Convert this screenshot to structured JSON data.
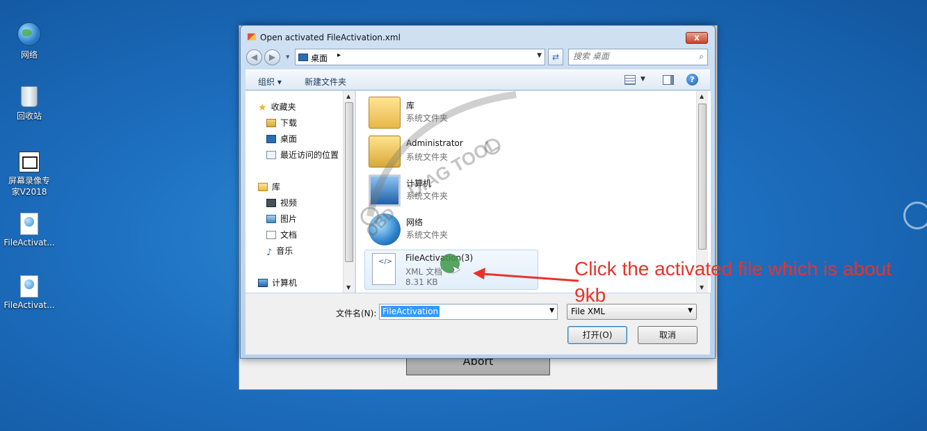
{
  "desktop": {
    "icons": [
      {
        "label": "网络",
        "icon": "network-icon"
      },
      {
        "label": "回收站",
        "icon": "recycle-bin-icon"
      },
      {
        "label": "屏幕录像专家V2018",
        "icon": "screen-recorder-icon"
      },
      {
        "label": "FileActivat...",
        "icon": "xml-file-icon"
      },
      {
        "label": "FileActivat...",
        "icon": "xml-file-icon"
      }
    ]
  },
  "background_window": {
    "abort_label": "Abort"
  },
  "dialog": {
    "title": "Open activated FileActivation.xml",
    "close_label": "x",
    "address": {
      "location": "桌面",
      "arrow": "▸"
    },
    "search": {
      "placeholder": "搜索 桌面"
    },
    "toolbar": {
      "organize": "组织 ▾",
      "new_folder": "新建文件夹",
      "help": "?"
    },
    "tree": {
      "favorites": "收藏夹",
      "downloads": "下载",
      "desktop": "桌面",
      "recent": "最近访问的位置",
      "libraries": "库",
      "videos": "视频",
      "pictures": "图片",
      "documents": "文档",
      "music": "音乐",
      "computer": "计算机"
    },
    "files": [
      {
        "name": "库",
        "type": "系统文件夹",
        "icon": "library-folder-icon"
      },
      {
        "name": "Administrator",
        "type": "系统文件夹",
        "icon": "user-folder-icon"
      },
      {
        "name": "计算机",
        "type": "系统文件夹",
        "icon": "computer-icon"
      },
      {
        "name": "网络",
        "type": "系统文件夹",
        "icon": "network-icon"
      },
      {
        "name": "FileActivation(3)",
        "type": "XML 文档",
        "size": "8.31 KB",
        "icon": "xml-file-icon",
        "selected": true
      }
    ],
    "filename_label": "文件名(N):",
    "filename_value": "FileActivation",
    "filetype_value": "File XML",
    "open_label": "打开(O)",
    "cancel_label": "取消"
  },
  "annotation": {
    "text": "Click the activated file which is about 9kb",
    "color": "#e8332a"
  },
  "watermark": {
    "text_top": "DIAG TOOL",
    "text_bottom": "OBD"
  },
  "colors": {
    "desktop_bg": "#1d6fc0",
    "selection": "#3399ff",
    "title_close": "#c8442a"
  }
}
